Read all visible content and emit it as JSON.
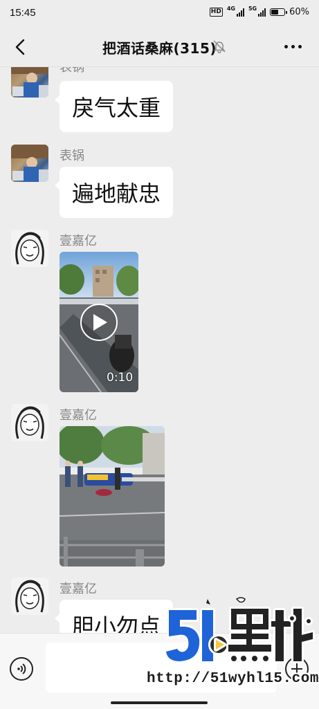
{
  "status_bar": {
    "time": "15:45",
    "hd": "HD",
    "net1": "4G",
    "net2": "5G",
    "battery_text": "60%",
    "battery_level": 0.6
  },
  "header": {
    "title": "把酒话桑麻(315)",
    "back_icon": "chevron-left-icon",
    "mute_icon": "bell-off-icon",
    "more_icon": "more-horizontal-icon"
  },
  "messages": [
    {
      "sender": "表锅",
      "type": "text",
      "text": "戾气太重"
    },
    {
      "sender": "表锅",
      "type": "text",
      "text": "遍地献忠"
    },
    {
      "sender": "壹嘉亿",
      "type": "video",
      "duration": "0:10"
    },
    {
      "sender": "壹嘉亿",
      "type": "image"
    },
    {
      "sender": "壹嘉亿",
      "type": "text",
      "text": "胆小勿点"
    }
  ],
  "input_bar": {
    "voice_icon": "voice-icon",
    "placeholder": "",
    "plus_icon": "plus-icon"
  },
  "watermark": {
    "url": "http://51wyhl15.com"
  },
  "colors": {
    "background": "#ededed",
    "bubble": "#ffffff",
    "sender_text": "#888888"
  }
}
